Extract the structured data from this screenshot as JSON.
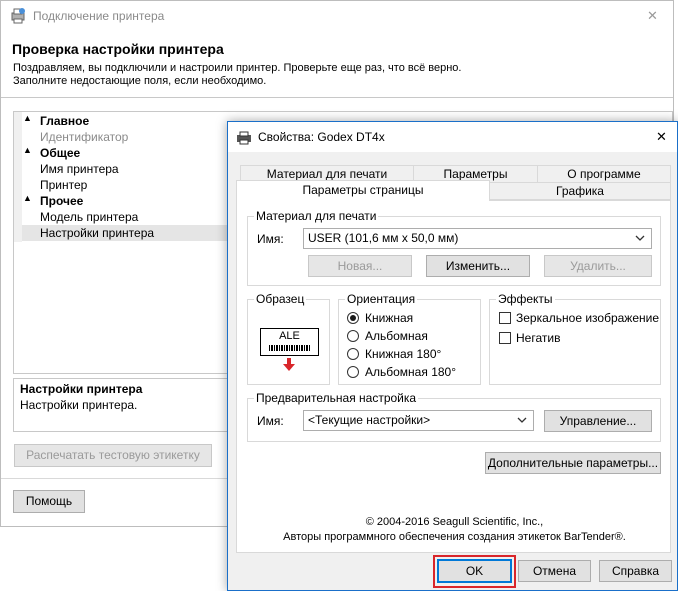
{
  "wizard": {
    "title": "Подключение принтера",
    "heading": "Проверка настройки принтера",
    "description_line1": "Поздравляем, вы подключили и настроили принтер.  Проверьте еще раз, что всё верно.",
    "description_line2": "Заполните недостающие поля, если необходимо.",
    "tree": [
      {
        "label": "Главное",
        "type": "header"
      },
      {
        "label": "Идентификатор",
        "type": "item-disabled"
      },
      {
        "label": "Общее",
        "type": "header"
      },
      {
        "label": "Имя принтера",
        "type": "item"
      },
      {
        "label": "Принтер",
        "type": "item"
      },
      {
        "label": "Прочее",
        "type": "header"
      },
      {
        "label": "Модель принтера",
        "type": "item"
      },
      {
        "label": "Настройки принтера",
        "type": "item-selected"
      }
    ],
    "info_title": "Настройки принтера",
    "info_text": "Настройки принтера.",
    "test_button": "Распечатать тестовую этикетку",
    "help_button": "Помощь",
    "close_glyph": "✕"
  },
  "dialog": {
    "title": "Свойства: Godex DT4x",
    "close_glyph": "✕",
    "tabs_row1": [
      "Материал для печати",
      "Параметры",
      "О программе"
    ],
    "tabs_row2": [
      "Параметры страницы",
      "Графика"
    ],
    "active_tab": "Параметры страницы",
    "media": {
      "group_label": "Материал для печати",
      "name_label": "Имя:",
      "name_value": "USER (101,6 мм x 50,0 мм)",
      "new_button": "Новая...",
      "edit_button": "Изменить...",
      "delete_button": "Удалить..."
    },
    "sample": {
      "group_label": "Образец",
      "preview_text": "ALE"
    },
    "orientation": {
      "group_label": "Ориентация",
      "options": [
        "Книжная",
        "Альбомная",
        "Книжная 180°",
        "Альбомная 180°"
      ],
      "selected_index": 0
    },
    "effects": {
      "group_label": "Эффекты",
      "options": [
        "Зеркальное изображение",
        "Негатив"
      ],
      "checked": [
        false,
        false
      ]
    },
    "preset": {
      "group_label": "Предварительная настройка",
      "name_label": "Имя:",
      "name_value": "<Текущие настройки>",
      "manage_button": "Управление..."
    },
    "advanced_button": "Дополнительные параметры...",
    "copyright_line1": "© 2004-2016 Seagull Scientific, Inc.,",
    "copyright_line2": "Авторы программного обеспечения создания этикеток BarTender®.",
    "ok_button": "OK",
    "cancel_button": "Отмена",
    "help_button": "Справка"
  },
  "colors": {
    "highlight_red": "#d9262b",
    "ok_border": "#0078d7",
    "selection": "#e5e5e5",
    "disabled_text": "#8a8a8a"
  },
  "icons": {
    "wizard_icon": "printer-wizard-icon",
    "dialog_icon": "printer-icon",
    "dropdown_icon": "chevron-down-icon",
    "preview_arrow": "arrow-down-icon"
  }
}
